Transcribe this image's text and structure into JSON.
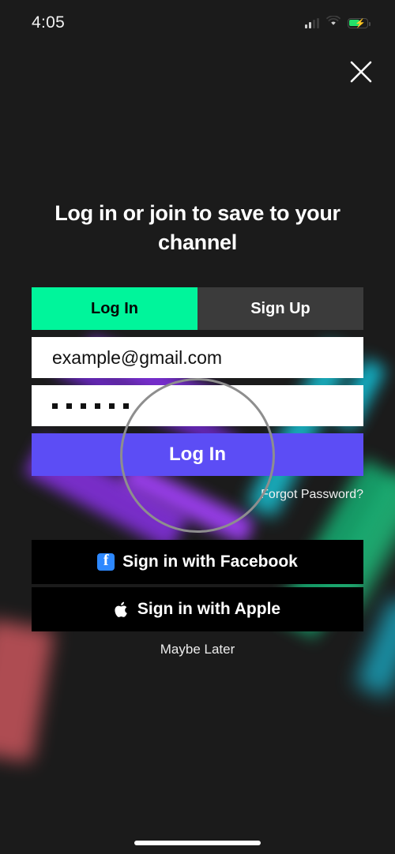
{
  "status_bar": {
    "time": "4:05",
    "signal_icon": "cellular-signal-icon",
    "wifi_icon": "wifi-icon",
    "battery_icon": "battery-charging-icon"
  },
  "header": {
    "close_icon": "close-icon"
  },
  "main": {
    "heading": "Log in or join to save to your channel",
    "tabs": [
      {
        "label": "Log In",
        "active": true
      },
      {
        "label": "Sign Up",
        "active": false
      }
    ],
    "email": {
      "value": "example@gmail.com",
      "placeholder": "Email"
    },
    "password": {
      "value": "••••••",
      "placeholder": "Password",
      "dot_count": 6
    },
    "login_button": "Log In",
    "forgot_password": "Forgot Password?",
    "social_buttons": [
      {
        "label": "Sign in with Facebook",
        "icon": "facebook-icon"
      },
      {
        "label": "Sign in with Apple",
        "icon": "apple-icon"
      }
    ],
    "maybe_later": "Maybe Later"
  },
  "colors": {
    "background": "#1b1b1b",
    "tab_active": "#00f59b",
    "tab_inactive": "#3b3b3b",
    "login_button": "#5c4df5",
    "facebook_blue": "#2d88ff",
    "field_background": "#ffffff",
    "text_primary": "#ffffff",
    "tap_ring": "#8e8e8e"
  }
}
